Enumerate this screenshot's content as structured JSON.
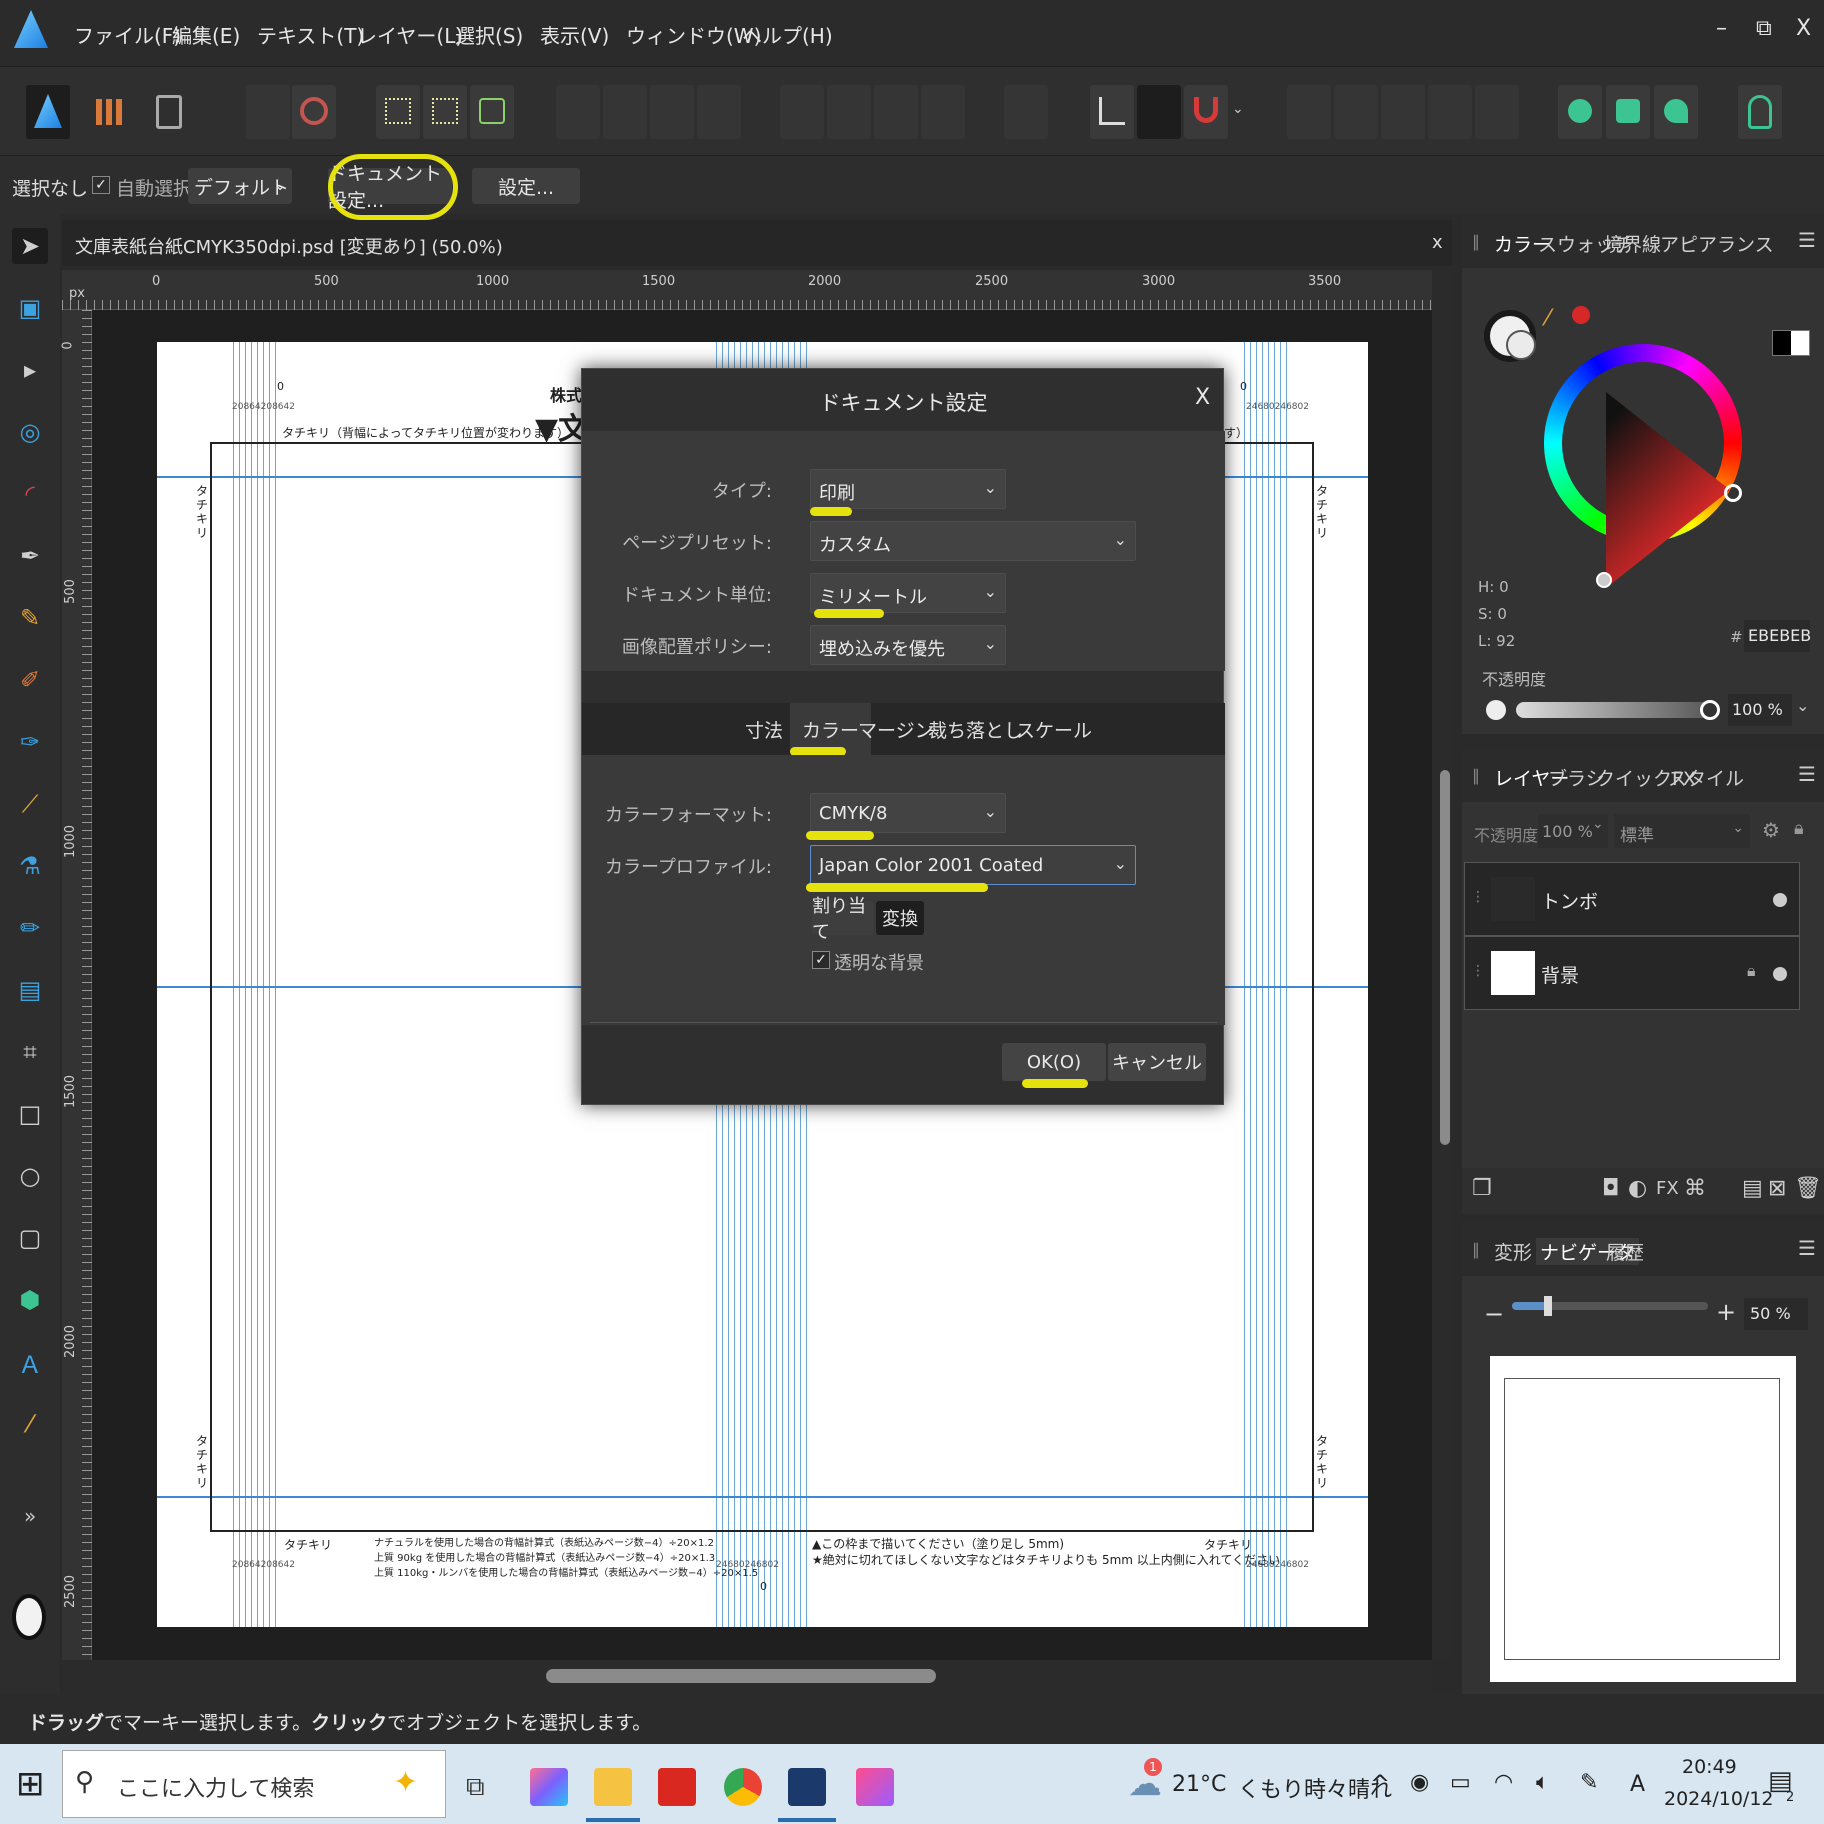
{
  "menubar": {
    "items": [
      "ファイル(F)",
      "編集(E)",
      "テキスト(T)",
      "レイヤー(L)",
      "選択(S)",
      "表示(V)",
      "ウィンドウ(W)",
      "ヘルプ(H)"
    ],
    "minimize": "–",
    "restore": "⧉",
    "close": "X"
  },
  "context_bar": {
    "selection": "選択なし",
    "auto_select_label": "自動選択:",
    "auto_select_checked": true,
    "auto_select_value": "デフォルト",
    "doc_settings_button": "ドキュメント設定...",
    "settings_button": "設定..."
  },
  "document": {
    "title": "文庫表紙台紙CMYK350dpi.psd [変更あり] (50.0%)",
    "close": "x",
    "ruler_unit": "px",
    "ruler_h_labels": [
      "0",
      "500",
      "1000",
      "1500",
      "2000",
      "2500",
      "3000",
      "3500"
    ],
    "ruler_v_labels": [
      "0",
      "500",
      "1000",
      "1500",
      "2000",
      "2500"
    ]
  },
  "page_text": {
    "company_top": "株式会",
    "title_top": "▼文",
    "trim_note_left": "タチキリ（背幅によってタチキリ位置が変わります）",
    "trim_note_right": "す）",
    "side_label": "タチキリ",
    "bottom_trim_left": "タチキリ",
    "bottom_trim_right": "タチキリ",
    "spine_formula": [
      "ナチュラルを使用した場合の背幅計算式（表紙込みページ数−4）÷20×1.2",
      "上質 90kg を使用した場合の背幅計算式（表紙込みページ数−4）÷20×1.3",
      "上質 110kg・ルンバを使用した場合の背幅計算式（表紙込みページ数−4）÷20×1.5"
    ],
    "bleed_note": [
      "▲この枠まで描いてください（塗り足し 5mm)",
      "★絶対に切れてほしくない文字などはタチキリよりも 5mm 以上内側に入れてください"
    ],
    "small_left": "20864208642",
    "small_right": "24680246802",
    "zero": "0"
  },
  "dialog": {
    "title": "ドキュメント設定",
    "close": "X",
    "type_label": "タイプ:",
    "type_value": "印刷",
    "preset_label": "ページプリセット:",
    "preset_value": "カスタム",
    "unit_label": "ドキュメント単位:",
    "unit_value": "ミリメートル",
    "policy_label": "画像配置ポリシー:",
    "policy_value": "埋め込みを優先",
    "tabs": [
      "寸法",
      "カラー",
      "マージン",
      "裁ち落とし",
      "スケール"
    ],
    "active_tab": "カラー",
    "color_format_label": "カラーフォーマット:",
    "color_format_value": "CMYK/8",
    "color_profile_label": "カラープロファイル:",
    "color_profile_value": "Japan Color 2001 Coated",
    "assign_button": "割り当て",
    "convert_button": "変換",
    "transparent_label": "透明な背景",
    "transparent_checked": true,
    "ok_button": "OK(O)",
    "cancel_button": "キャンセル",
    "highlight_color": "#e5e20e"
  },
  "color_panel": {
    "tabs": [
      "カラー",
      "スウォッチ",
      "境界線",
      "アピアランス"
    ],
    "h": "H: 0",
    "s": "S: 0",
    "l": "L: 92",
    "hex_prefix": "#:",
    "hex": "EBEBEB",
    "opacity_label": "不透明度",
    "opacity_value": "100 %",
    "opacity_fraction": 1.0
  },
  "layers_panel": {
    "tabs": [
      "レイヤー",
      "ブラシ",
      "クイックFX",
      "スタイル"
    ],
    "opacity_label": "不透明度:",
    "opacity_value": "100 %",
    "blend_mode": "標準",
    "layers": [
      {
        "name": "トンボ"
      },
      {
        "name": "背景"
      }
    ]
  },
  "navigator_panel": {
    "tabs": [
      "変形",
      "ナビゲータ",
      "履歴"
    ],
    "zoom": "50 %",
    "zoom_minus": "−",
    "zoom_plus": "+"
  },
  "status": {
    "hint_bold1": "ドラッグ",
    "hint1": "でマーキー選択します。",
    "hint_bold2": "クリック",
    "hint2": "でオブジェクトを選択します。"
  },
  "taskbar": {
    "search_placeholder": "ここに入力して検索",
    "weather_temp": "21°C",
    "weather_text": "くもり時々晴れ",
    "weather_badge": "1",
    "time": "20:49",
    "date": "2024/10/12",
    "ime": "A",
    "notification_count": "2"
  },
  "tools_more": "»"
}
